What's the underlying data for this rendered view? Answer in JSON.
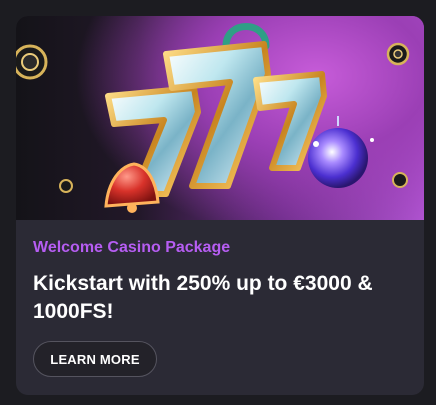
{
  "promo": {
    "title": "Welcome Casino Package",
    "headline": "Kickstart with 250% up to €3000 & 1000FS!",
    "cta_label": "LEARN MORE",
    "banner_image": "lucky-sevens-casino-illustration"
  },
  "colors": {
    "page_background": "#1c1c21",
    "card_background": "#2b2a35",
    "eyebrow_accent": "#b65df2",
    "button_border": "#55545f"
  }
}
